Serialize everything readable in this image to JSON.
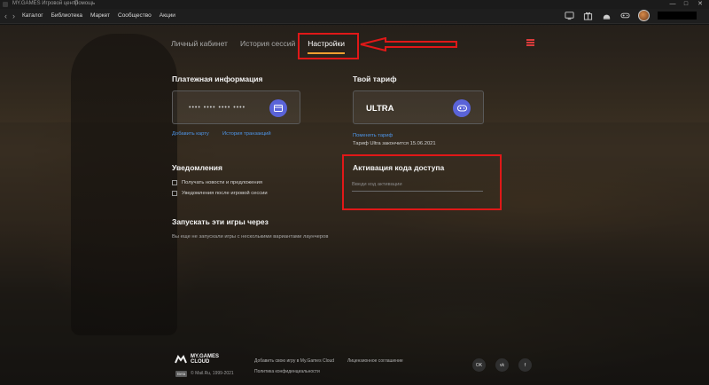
{
  "titlebar": {
    "app_title": "MY.GAMES Игровой центр",
    "help": "Помощь",
    "minimize": "—",
    "maximize": "□",
    "close": "✕"
  },
  "nav": {
    "back": "‹",
    "forward": "›",
    "links": [
      "Каталог",
      "Библиотека",
      "Маркет",
      "Сообщество",
      "Акции"
    ],
    "icons": [
      "screen-icon",
      "gift-icon",
      "robot-icon",
      "controller-icon"
    ]
  },
  "tabs": [
    "Личный кабинет",
    "История сессий",
    "Настройки"
  ],
  "payment": {
    "title": "Платежная информация",
    "card_dots": "•••• •••• •••• ••••",
    "add_card": "Добавить карту",
    "history": "История транзакций"
  },
  "tariff": {
    "title": "Твой тариф",
    "plan": "ULTRA",
    "change": "Поменять тариф",
    "expired": "Тариф Ultra закончится 15.06.2021"
  },
  "notifications": {
    "title": "Уведомления",
    "options": [
      "Получать новости и предложения",
      "Уведомления после игровой сессии"
    ]
  },
  "activation": {
    "title": "Активация кода доступа",
    "placeholder": "Введи код активации"
  },
  "launch": {
    "title": "Запускать эти игры через",
    "note": "Вы еще не запускали игры с несколькими вариантами лаунчеров"
  },
  "footer": {
    "logo_line1": "MY.GAMES",
    "logo_line2": "CLOUD",
    "beta": "Beta",
    "copyright": "© Mail.Ru, 1999-2021",
    "links": [
      "Добавить свою игру в My.Games Cloud",
      "Лицензионное соглашение",
      "Политика конфиденциальности"
    ],
    "social": [
      "OK",
      "vk",
      "f"
    ]
  },
  "colors": {
    "accent": "#f0a030",
    "link": "#4e95e8",
    "button": "#5a63d8",
    "annotation": "#e01818"
  }
}
